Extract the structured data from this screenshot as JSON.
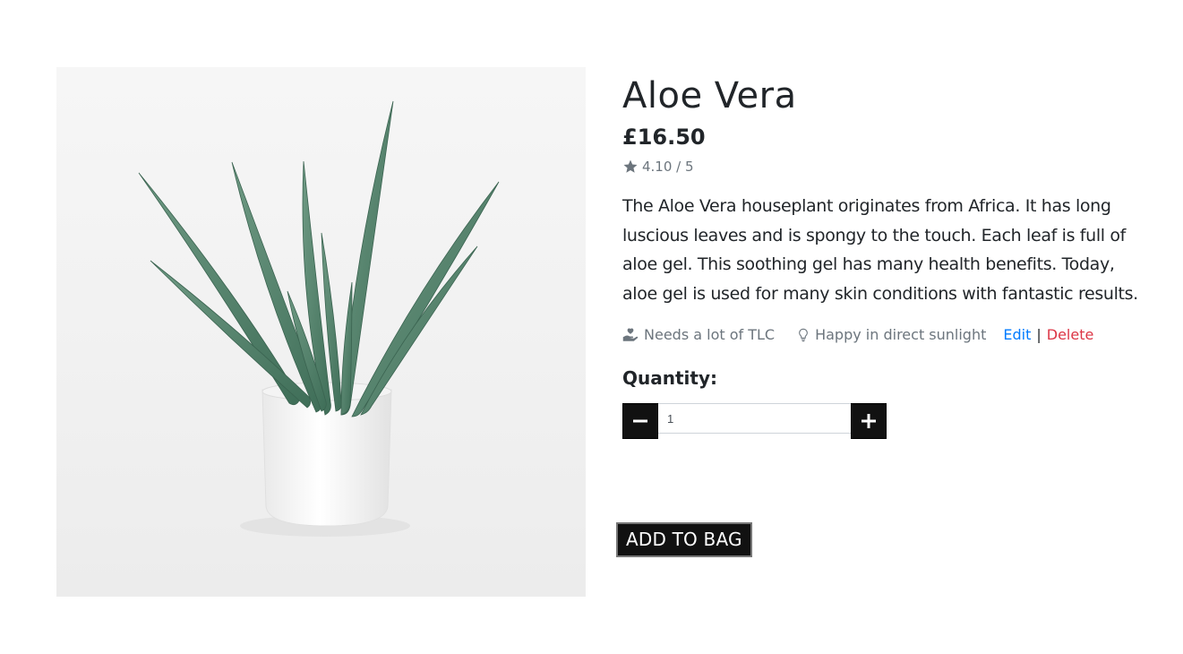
{
  "product": {
    "name": "Aloe Vera",
    "price": "£16.50",
    "rating": "4.10 / 5",
    "description": "The Aloe Vera houseplant originates from Africa. It has long luscious leaves and is spongy to the touch. Each leaf is full of aloe gel. This soothing gel has many health benefits. Today, aloe gel is used for many skin conditions with fantastic results.",
    "image_icon": "aloe-vera-plant-photo"
  },
  "meta": {
    "care": "Needs a lot of TLC",
    "care_icon": "hand-holding-heart-icon",
    "light": "Happy in direct sunlight",
    "light_icon": "lightbulb-icon",
    "edit": "Edit",
    "separator": "|",
    "delete": "Delete"
  },
  "quantity": {
    "label": "Quantity:",
    "value": "1",
    "decrement_icon": "minus-icon",
    "increment_icon": "plus-icon"
  },
  "actions": {
    "add_to_bag": "ADD TO BAG"
  },
  "colors": {
    "edit": "#007bff",
    "delete": "#dc3545",
    "muted": "#6c757d",
    "button_dark": "#111111"
  }
}
